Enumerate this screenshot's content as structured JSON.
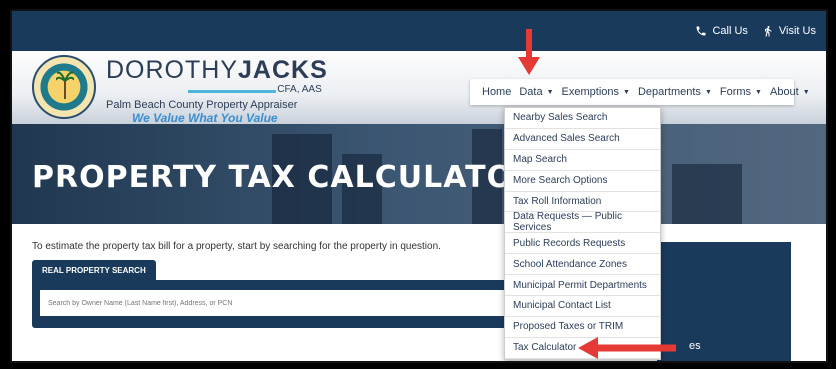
{
  "topbar": {
    "call_label": "Call Us",
    "visit_label": "Visit Us"
  },
  "brand": {
    "name_light": "DOROTHY",
    "name_bold": "JACKS",
    "credentials": "CFA, AAS",
    "subtitle": "Palm Beach County Property Appraiser",
    "tagline": "We Value What You Value"
  },
  "nav": {
    "items": [
      {
        "label": "Home"
      },
      {
        "label": "Data"
      },
      {
        "label": "Exemptions"
      },
      {
        "label": "Departments"
      },
      {
        "label": "Forms"
      },
      {
        "label": "About"
      }
    ]
  },
  "dropdown": {
    "items": [
      "Nearby Sales Search",
      "Advanced Sales Search",
      "Map Search",
      "More Search Options",
      "Tax Roll Information",
      "Data Requests — Public Services",
      "Public Records Requests",
      "School Attendance Zones",
      "Municipal Permit Departments",
      "Municipal Contact List",
      "Proposed Taxes or TRIM",
      "Tax Calculator"
    ]
  },
  "hero": {
    "title": "PROPERTY TAX CALCULATOR"
  },
  "main": {
    "intro": "To estimate the property tax bill for a property, start by searching for the property in question.",
    "tab_label": "REAL PROPERTY SEARCH",
    "search_placeholder": "Search by Owner Name (Last Name first), Address, or PCN",
    "right_panel_text": "es"
  },
  "annotations": {
    "arrow_color": "#e53935"
  },
  "icons": {
    "call": "phone-icon",
    "visit": "walking-person-icon"
  }
}
